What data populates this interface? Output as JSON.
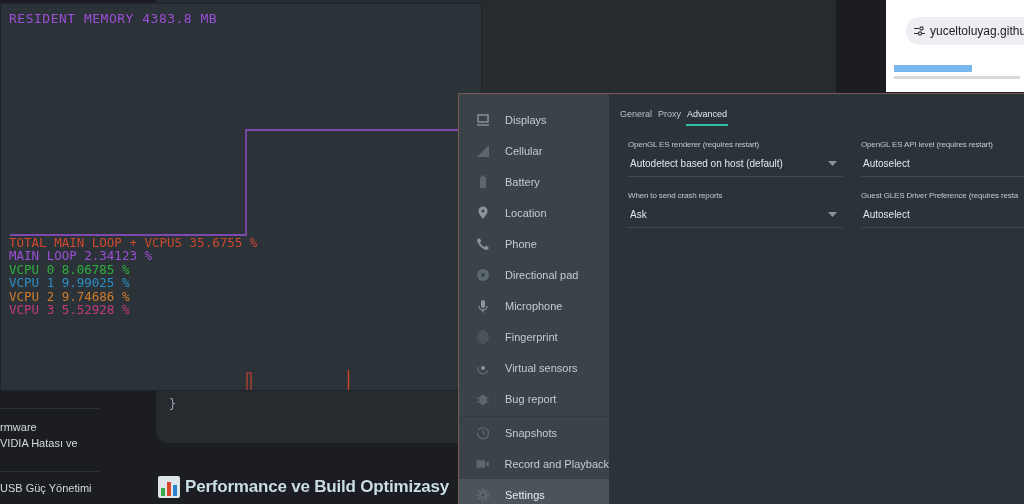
{
  "blog": {
    "sidebar_items": [
      "rmware",
      "VIDIA Hatası ve",
      "USB Güç Yönetimi"
    ],
    "code_tail": "}",
    "heading": "Performance ve Build Optimizasy"
  },
  "perf_window": {
    "memory": "RESIDENT MEMORY 4383.8 MB",
    "stats": [
      {
        "text": "TOTAL MAIN LOOP + VCPUS 35.6755 %",
        "color": "#d0482c"
      },
      {
        "text": "MAIN LOOP 2.34123 %",
        "color": "#9c4fd8"
      },
      {
        "text": "VCPU 0 8.06785 %",
        "color": "#2fb03c"
      },
      {
        "text": "VCPU 1 9.99025 %",
        "color": "#2b8fc6"
      },
      {
        "text": "VCPU 2 9.74686 %",
        "color": "#d27a2a"
      },
      {
        "text": "VCPU 3 5.52928 %",
        "color": "#c23a7c"
      }
    ]
  },
  "browser": {
    "url": "yuceltoluyag.githu"
  },
  "emulator": {
    "nav_groups": [
      [
        {
          "label": "Displays",
          "kind": "display",
          "selected": false
        },
        {
          "label": "Cellular",
          "kind": "cellular",
          "selected": false
        },
        {
          "label": "Battery",
          "kind": "battery",
          "selected": false
        },
        {
          "label": "Location",
          "kind": "location",
          "selected": false
        },
        {
          "label": "Phone",
          "kind": "phone",
          "selected": false
        },
        {
          "label": "Directional pad",
          "kind": "dpad",
          "selected": false
        },
        {
          "label": "Microphone",
          "kind": "mic",
          "selected": false
        },
        {
          "label": "Fingerprint",
          "kind": "fingerprint",
          "selected": false
        },
        {
          "label": "Virtual sensors",
          "kind": "sensors",
          "selected": false
        },
        {
          "label": "Bug report",
          "kind": "bug",
          "selected": false
        }
      ],
      [
        {
          "label": "Snapshots",
          "kind": "history",
          "selected": false
        },
        {
          "label": "Record and Playback",
          "kind": "camera",
          "selected": false
        },
        {
          "label": "Settings",
          "kind": "gear",
          "selected": true
        }
      ]
    ],
    "tabs": [
      {
        "label": "General",
        "selected": false
      },
      {
        "label": "Proxy",
        "selected": false
      },
      {
        "label": "Advanced",
        "selected": true
      }
    ],
    "fields": [
      {
        "label": "OpenGL ES renderer (requires restart)",
        "value": "Autodetect based on host (default)",
        "arrow": true
      },
      {
        "label": "OpenGL ES API level (requires restart)",
        "value": "Autoselect"
      },
      {
        "label": "When to send crash reports",
        "value": "Ask",
        "arrow": true
      },
      {
        "label": "Guest GLES Driver Preference (requires resta",
        "value": "Autoselect"
      }
    ]
  }
}
